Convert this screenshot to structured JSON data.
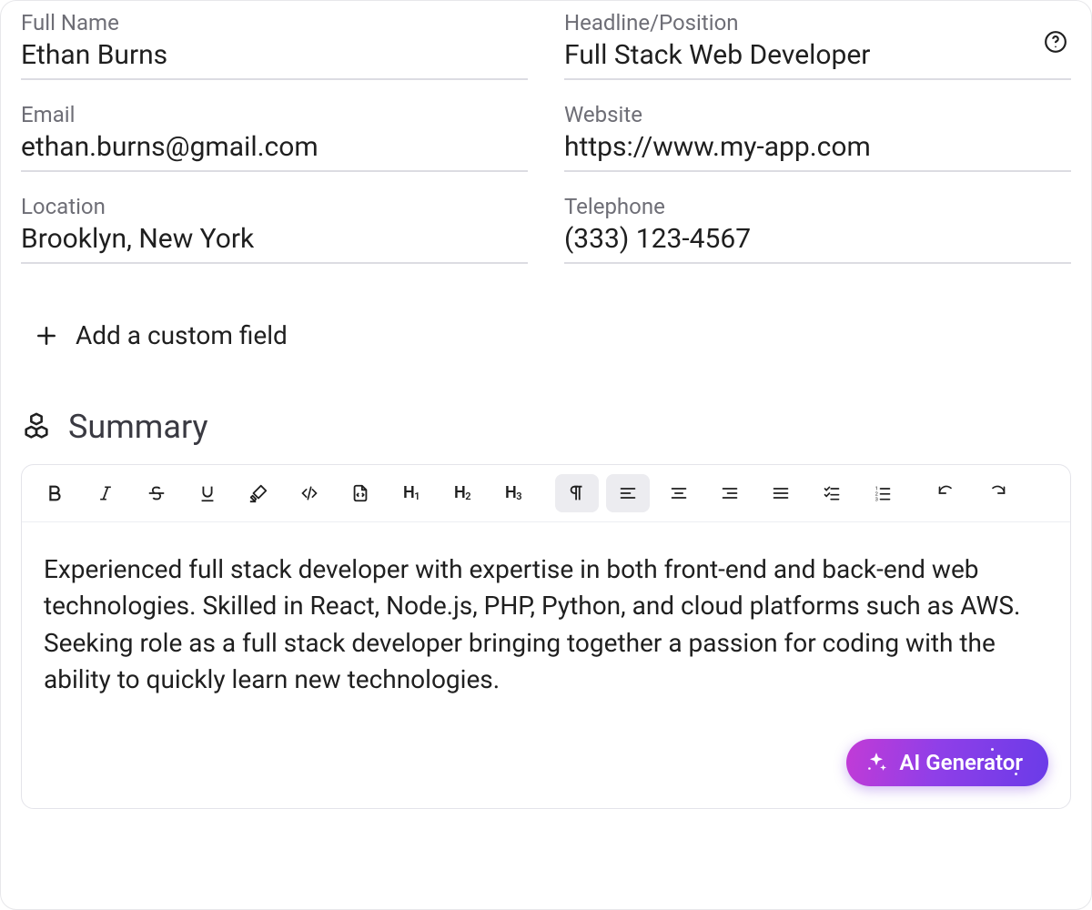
{
  "fields": {
    "full_name": {
      "label": "Full Name",
      "value": "Ethan Burns"
    },
    "headline": {
      "label": "Headline/Position",
      "value": "Full Stack Web Developer"
    },
    "email": {
      "label": "Email",
      "value": "ethan.burns@gmail.com"
    },
    "website": {
      "label": "Website",
      "value": "https://www.my-app.com"
    },
    "location": {
      "label": "Location",
      "value": "Brooklyn, New York"
    },
    "telephone": {
      "label": "Telephone",
      "value": "(333) 123-4567"
    }
  },
  "add_custom_label": "Add a custom field",
  "summary": {
    "title": "Summary",
    "body": "Experienced full stack developer with expertise in both front-end and back-end web technologies. Skilled in React, Node.js, PHP, Python, and cloud platforms such as AWS. Seeking role as a full stack developer bringing together a passion for coding with the ability to quickly learn new technologies."
  },
  "toolbar": {
    "h1": "H1",
    "h2": "H2",
    "h3": "H3"
  },
  "ai_button_label": "AI Generator"
}
